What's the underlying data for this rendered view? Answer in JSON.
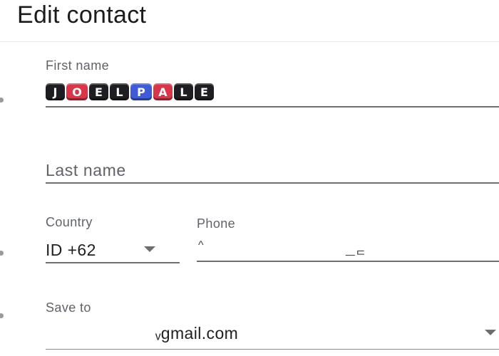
{
  "header": {
    "title": "Edit contact"
  },
  "first_name": {
    "label": "First name",
    "tiles": [
      {
        "char": "J",
        "color": "black"
      },
      {
        "char": "O",
        "color": "red"
      },
      {
        "char": "E",
        "color": "black"
      },
      {
        "char": "L",
        "color": "black"
      },
      {
        "char": "P",
        "color": "blue"
      },
      {
        "char": "A",
        "color": "red"
      },
      {
        "char": "L",
        "color": "black"
      },
      {
        "char": "E",
        "color": "black"
      }
    ]
  },
  "last_name": {
    "placeholder": "Last name"
  },
  "country": {
    "label": "Country",
    "value": "ID +62",
    "dropdown_icon": "caret-down-icon"
  },
  "phone": {
    "label": "Phone",
    "fragment_start": "^",
    "fragment_end": "ᅳᄃ"
  },
  "save_to": {
    "label": "Save to",
    "value": "ᵥgmail.com",
    "dropdown_icon": "caret-down-icon"
  }
}
